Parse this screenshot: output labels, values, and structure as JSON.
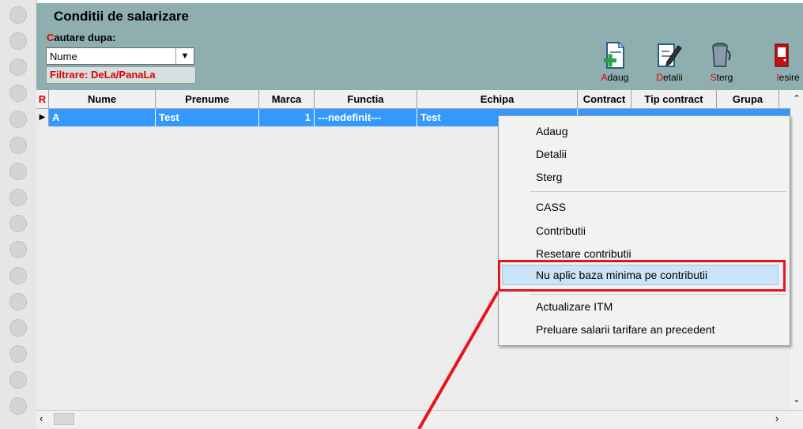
{
  "window": {
    "title": "Conditii de salarizare",
    "search_label_first": "C",
    "search_label_rest": "autare dupa:",
    "search_value": "Nume",
    "filter_label": "Filtrare: DeLa/PanaLa"
  },
  "toolbar": {
    "add": {
      "hot": "A",
      "rest": "daug"
    },
    "details": {
      "hot": "D",
      "rest": "etalii"
    },
    "delete": {
      "hot": "S",
      "rest": "terg"
    },
    "exit": {
      "hot": "I",
      "rest": "esire"
    }
  },
  "grid": {
    "columns": [
      "R",
      "Nume",
      "Prenume",
      "Marca",
      "Functia",
      "Echipa",
      "Contract",
      "Tip contract",
      "Grupa"
    ],
    "rows": [
      {
        "nume": "A",
        "prenume": "Test",
        "marca": "1",
        "functia": "---nedefinit---",
        "echipa": "Test"
      }
    ]
  },
  "context_menu": {
    "items": [
      "Adaug",
      "Detalii",
      "Sterg",
      "CASS",
      "Contributii",
      "Resetare contributii",
      "Nu aplic baza minima pe contributii",
      "Actualizare ITM",
      "Preluare salarii tarifare an precedent"
    ],
    "highlighted": "Nu aplic baza minima pe contributii"
  },
  "colors": {
    "accent": "#3399ff",
    "highlight_box": "#e8141c",
    "header_band": "#8faeb0"
  }
}
